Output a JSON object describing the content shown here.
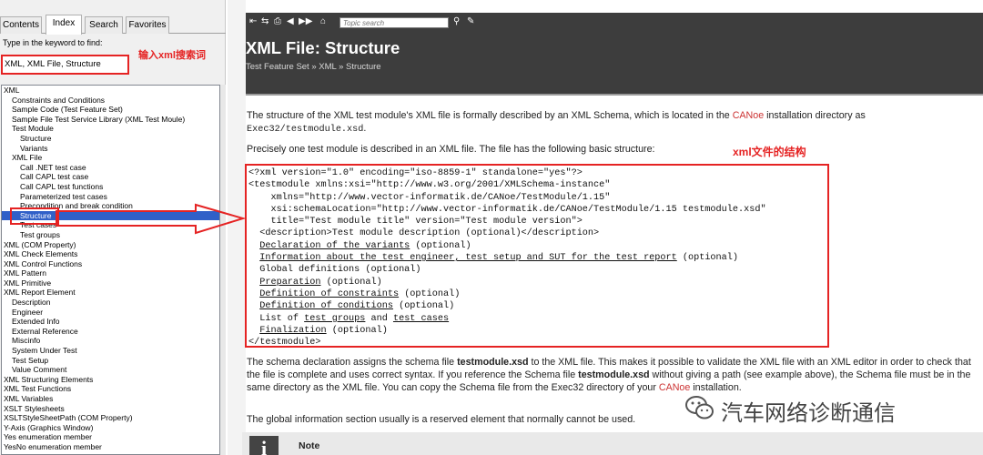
{
  "left_pane": {
    "tabs": [
      "Contents",
      "Index",
      "Search",
      "Favorites"
    ],
    "active_tab": "Index",
    "keyword_label": "Type in the keyword to find:",
    "keyword_value": "XML, XML File, Structure",
    "annotation": "输入xml搜索词",
    "index_items": [
      {
        "text": "XML",
        "indent": 0
      },
      {
        "text": "Constraints and Conditions",
        "indent": 1
      },
      {
        "text": "Sample Code (Test Feature Set)",
        "indent": 1
      },
      {
        "text": "Sample File Test Service Library (XML Test Moule)",
        "indent": 1
      },
      {
        "text": "Test Module",
        "indent": 1
      },
      {
        "text": "Structure",
        "indent": 2
      },
      {
        "text": "Variants",
        "indent": 2
      },
      {
        "text": "XML File",
        "indent": 1
      },
      {
        "text": "Call .NET test case",
        "indent": 2
      },
      {
        "text": "Call CAPL test case",
        "indent": 2
      },
      {
        "text": "Call CAPL test functions",
        "indent": 2
      },
      {
        "text": "Parameterized test cases",
        "indent": 2
      },
      {
        "text": "Precondition and break condition",
        "indent": 2
      },
      {
        "text": "Structure",
        "indent": 2,
        "selected": true
      },
      {
        "text": "Test cases",
        "indent": 2
      },
      {
        "text": "Test groups",
        "indent": 2
      },
      {
        "text": "XML (COM Property)",
        "indent": 0
      },
      {
        "text": "XML Check Elements",
        "indent": 0
      },
      {
        "text": "XML Control Functions",
        "indent": 0
      },
      {
        "text": "XML Pattern",
        "indent": 0
      },
      {
        "text": "XML Primitive",
        "indent": 0
      },
      {
        "text": "XML Report Element",
        "indent": 0
      },
      {
        "text": "Description",
        "indent": 1
      },
      {
        "text": "Engineer",
        "indent": 1
      },
      {
        "text": "Extended Info",
        "indent": 1
      },
      {
        "text": "External Reference",
        "indent": 1
      },
      {
        "text": "Miscinfo",
        "indent": 1
      },
      {
        "text": "System Under Test",
        "indent": 1
      },
      {
        "text": "Test Setup",
        "indent": 1
      },
      {
        "text": "Value Comment",
        "indent": 1
      },
      {
        "text": "XML Structuring Elements",
        "indent": 0
      },
      {
        "text": "XML Test Functions",
        "indent": 0
      },
      {
        "text": "XML Variables",
        "indent": 0
      },
      {
        "text": "XSLT Stylesheets",
        "indent": 0
      },
      {
        "text": "XSLTStyleSheetPath (COM Property)",
        "indent": 0
      },
      {
        "text": "Y-Axis (Graphics Window)",
        "indent": 0
      },
      {
        "text": "Yes enumeration member",
        "indent": 0
      },
      {
        "text": "YesNo enumeration member",
        "indent": 0
      }
    ]
  },
  "toolbar": {
    "search_placeholder": "Topic search",
    "icons": [
      "hide-toc-icon",
      "locate-icon",
      "print-icon",
      "back-icon",
      "forward-icon",
      "home-icon",
      "search-go-icon",
      "highlight-icon"
    ]
  },
  "page": {
    "title": "XML File: Structure",
    "breadcrumb": "Test Feature Set » XML » Structure",
    "para1_before_link": "The structure of the XML test module's XML file is formally described by an XML Schema, which is located in the ",
    "para1_link": "CANoe",
    "para1_after_link": " installation directory as",
    "para1_code": "Exec32/testmodule.xsd",
    "para1_end": ".",
    "para2": "Precisely one test module is described in an XML file. The file has the following basic structure:",
    "annotation": "xml文件的结构",
    "code_lines": [
      {
        "segments": [
          {
            "t": "<?xml version=\"1.0\" encoding=\"iso-8859-1\" standalone=\"yes\"?>"
          }
        ]
      },
      {
        "segments": [
          {
            "t": "<testmodule xmlns:xsi=\"http://www.w3.org/2001/XMLSchema-instance\""
          }
        ]
      },
      {
        "segments": [
          {
            "t": "    xmlns=\"http://www.vector-informatik.de/CANoe/TestModule/1.15\""
          }
        ]
      },
      {
        "segments": [
          {
            "t": "    xsi:schemaLocation=\"http://www.vector-informatik.de/CANoe/TestModule/1.15 testmodule.xsd\""
          }
        ]
      },
      {
        "segments": [
          {
            "t": "    title=\"Test module title\" version=\"Test module version\">"
          }
        ]
      },
      {
        "segments": [
          {
            "t": "  <description>Test module description (optional)</description>"
          }
        ]
      },
      {
        "segments": [
          {
            "t": "  "
          },
          {
            "t": "Declaration of the variants",
            "u": true
          },
          {
            "t": " (optional)"
          }
        ]
      },
      {
        "segments": [
          {
            "t": "  "
          },
          {
            "t": "Information about the test engineer, test setup and SUT for the test report",
            "u": true
          },
          {
            "t": " (optional)"
          }
        ]
      },
      {
        "segments": [
          {
            "t": "  Global definitions (optional)"
          }
        ]
      },
      {
        "segments": [
          {
            "t": "  "
          },
          {
            "t": "Preparation",
            "u": true
          },
          {
            "t": " (optional)"
          }
        ]
      },
      {
        "segments": [
          {
            "t": "  "
          },
          {
            "t": "Definition of constraints",
            "u": true
          },
          {
            "t": " (optional)"
          }
        ]
      },
      {
        "segments": [
          {
            "t": "  "
          },
          {
            "t": "Definition of conditions",
            "u": true
          },
          {
            "t": " (optional)"
          }
        ]
      },
      {
        "segments": [
          {
            "t": "  List of "
          },
          {
            "t": "test groups",
            "u": true
          },
          {
            "t": " and "
          },
          {
            "t": "test cases",
            "u": true
          }
        ]
      },
      {
        "segments": [
          {
            "t": "  "
          },
          {
            "t": "Finalization",
            "u": true
          },
          {
            "t": " (optional)"
          }
        ]
      },
      {
        "segments": [
          {
            "t": "</testmodule>"
          }
        ]
      }
    ],
    "para3_a": "The schema declaration assigns the schema file ",
    "para3_b": "testmodule.xsd",
    "para3_c": " to the XML file. This makes it possible to validate the XML file with an XML editor in order to check that the file is complete and uses correct syntax. If you reference the Schema file ",
    "para3_d": "testmodule.xsd",
    "para3_e": " without giving a path (see example above), the Schema file must be in the same directory as the XML file. You can copy the Schema file from the Exec32 directory of your ",
    "para3_link": "CANoe",
    "para3_f": " installation.",
    "para4": "The global information section usually is a reserved element that normally cannot be used.",
    "note_label": "Note"
  },
  "watermark": "汽车网络诊断通信",
  "colors": {
    "annotation_red": "#e52323",
    "header_bg": "#3d3d3d",
    "selection": "#3060c8",
    "link": "#cc3333"
  }
}
